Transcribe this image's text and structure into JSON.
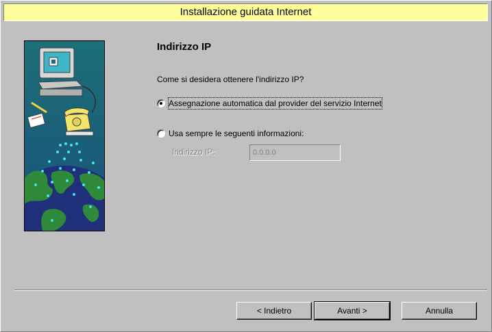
{
  "window": {
    "title": "Installazione guidata Internet"
  },
  "page": {
    "heading": "Indirizzo IP",
    "question": "Come si desidera ottenere l'indirizzo IP?",
    "options": [
      {
        "label": "Assegnazione automatica dal provider del servizio Internet",
        "selected": true
      },
      {
        "label": "Usa sempre le seguenti informazioni:",
        "selected": false
      }
    ],
    "ip_label": "Indirizzo IP:",
    "ip_value": "0.0.0.0"
  },
  "buttons": {
    "back": "< Indietro",
    "next": "Avanti >",
    "cancel": "Annulla"
  },
  "colors": {
    "title_bar": "#fffe9a",
    "face": "#c0c0c0",
    "illustration_sky": "#1c6f78",
    "illustration_ocean": "#1f2f7a",
    "illustration_land": "#2e8a3a"
  }
}
